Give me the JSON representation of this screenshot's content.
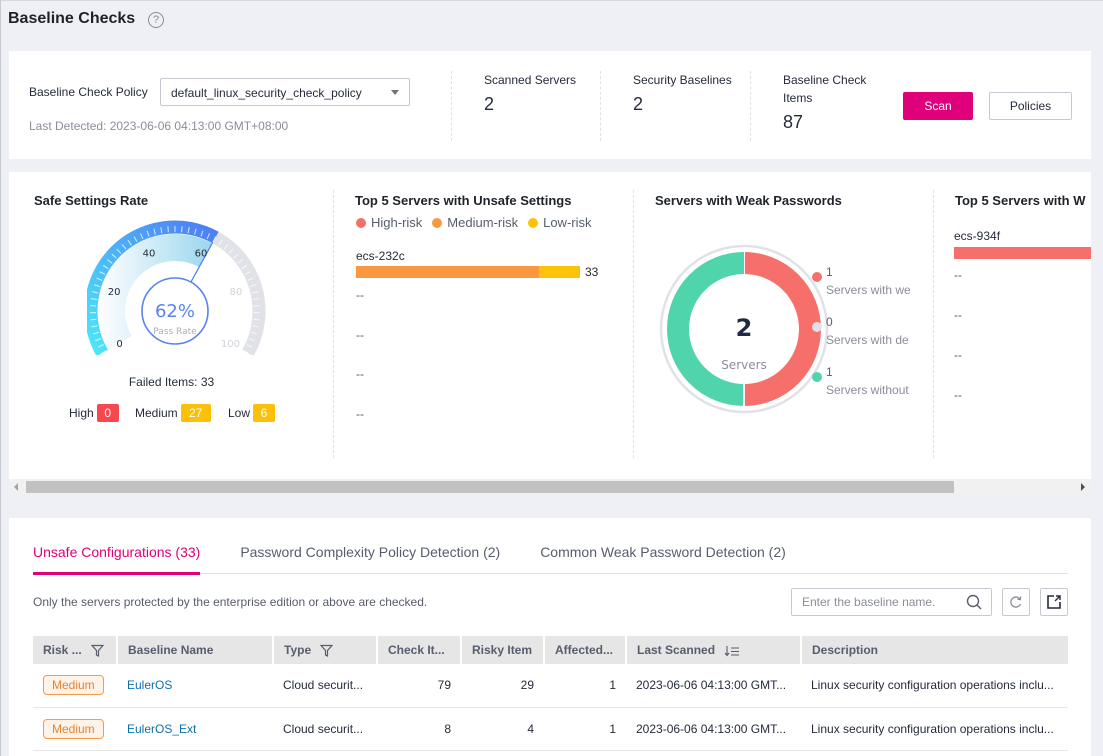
{
  "header": {
    "title": "Baseline Checks",
    "help_icon": "?"
  },
  "summary": {
    "policy_label": "Baseline Check Policy",
    "policy_value": "default_linux_security_check_policy",
    "last_detected": "Last Detected: 2023-06-06 04:13:00 GMT+08:00",
    "stats": [
      {
        "label": "Scanned Servers",
        "value": "2"
      },
      {
        "label": "Security Baselines",
        "value": "2"
      },
      {
        "label": "Baseline Check Items",
        "value": "87"
      }
    ],
    "scan_label": "Scan",
    "policies_label": "Policies",
    "colors": {
      "primary": "#e0007a"
    }
  },
  "safe_rate": {
    "title": "Safe Settings Rate",
    "percent": 62,
    "percent_label": "62%",
    "center_label": "Pass Rate",
    "ticks": [
      "0",
      "20",
      "40",
      "60",
      "80",
      "100"
    ],
    "failed_label": "Failed Items: 33",
    "risks": [
      {
        "label": "High",
        "count": "0",
        "color": "#f5484f"
      },
      {
        "label": "Medium",
        "count": "27",
        "color": "#fcbf0a"
      },
      {
        "label": "Low",
        "count": "6",
        "color": "#fcbf0a"
      }
    ]
  },
  "unsafe_top5": {
    "title": "Top 5 Servers with Unsafe Settings",
    "legend": [
      {
        "label": "High-risk",
        "color": "#f66f6a"
      },
      {
        "label": "Medium-risk",
        "color": "#fa9841"
      },
      {
        "label": "Low-risk",
        "color": "#fcc30a"
      }
    ],
    "servers": [
      {
        "name": "ecs-232c",
        "high": 0,
        "medium": 27,
        "low": 6,
        "total": "33"
      },
      {
        "name": "--"
      },
      {
        "name": "--"
      },
      {
        "name": "--"
      },
      {
        "name": "--"
      }
    ]
  },
  "weak_passwords": {
    "title": "Servers with Weak Passwords",
    "total": "2",
    "center_label": "Servers",
    "segments": [
      {
        "value": 1,
        "label": "Servers with we",
        "color": "#f66f6a"
      },
      {
        "value": 0,
        "label": "Servers with de",
        "color": "#dfe1e6"
      },
      {
        "value": 1,
        "label": "Servers without",
        "color": "#50d4ab"
      }
    ]
  },
  "weak_top5": {
    "title": "Top 5 Servers with W",
    "servers": [
      {
        "name": "ecs-934f"
      },
      {
        "name": "--"
      },
      {
        "name": "--"
      },
      {
        "name": "--"
      },
      {
        "name": "--"
      }
    ]
  },
  "tabs": [
    {
      "label": "Unsafe Configurations (33)",
      "active": true
    },
    {
      "label": "Password Complexity Policy Detection (2)",
      "active": false
    },
    {
      "label": "Common Weak Password Detection (2)",
      "active": false
    }
  ],
  "table_section": {
    "note": "Only the servers protected by the enterprise edition or above are checked.",
    "search_placeholder": "Enter the baseline name.",
    "columns": [
      "Risk ...",
      "Baseline Name",
      "Type",
      "Check It...",
      "Risky Item",
      "Affected...",
      "Last Scanned",
      "Description"
    ],
    "rows": [
      {
        "risk": "Medium",
        "name": "EulerOS",
        "type": "Cloud securit...",
        "check_items": "79",
        "risky_items": "29",
        "affected": "1",
        "last_scanned": "2023-06-06 04:13:00 GMT...",
        "description": "Linux security configuration operations inclu..."
      },
      {
        "risk": "Medium",
        "name": "EulerOS_Ext",
        "type": "Cloud securit...",
        "check_items": "8",
        "risky_items": "4",
        "affected": "1",
        "last_scanned": "2023-06-06 04:13:00 GMT...",
        "description": "Linux security configuration operations inclu..."
      }
    ]
  }
}
